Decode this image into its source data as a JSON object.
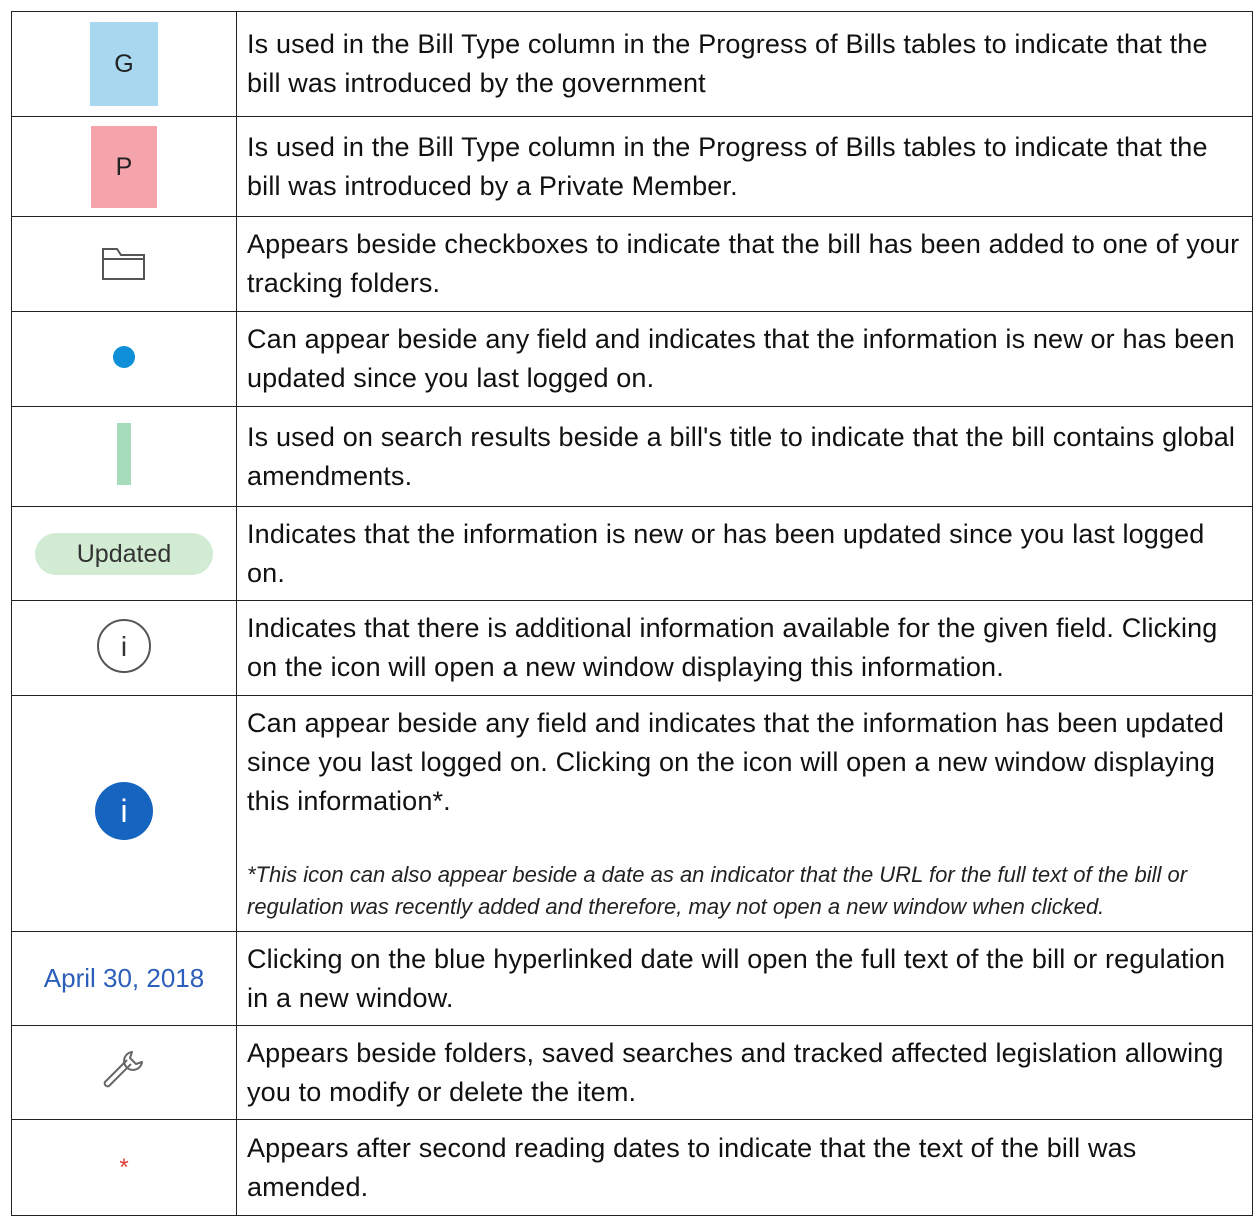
{
  "rows": [
    {
      "icon": "g-badge",
      "badge_text": "G",
      "color": "#a8d8ef",
      "description": "Is used in the Bill Type column in the Progress of Bills tables to indicate that the bill was introduced by the government"
    },
    {
      "icon": "p-badge",
      "badge_text": "P",
      "color": "#f4a4aa",
      "description": "Is used in the Bill Type column in the Progress of Bills tables to indicate that the bill was introduced by a Private Member."
    },
    {
      "icon": "folder-icon",
      "description": "Appears beside checkboxes to indicate that the bill has been added to one of your tracking folders."
    },
    {
      "icon": "blue-dot-icon",
      "color": "#0e8fd8",
      "description": "Can appear beside any field and indicates that the information is new or has been updated since you last logged on."
    },
    {
      "icon": "green-bar-icon",
      "color": "#a6dbbc",
      "description": "Is used on search results beside a bill's title to indicate that the bill contains global amendments."
    },
    {
      "icon": "updated-badge",
      "badge_text": "Updated",
      "color": "#d2ecd3",
      "description": "Indicates that the information is new or has been updated since you last logged on."
    },
    {
      "icon": "info-outline-icon",
      "glyph": "i",
      "description": "Indicates that there is additional information available for the given field. Clicking on the icon will open a new window displaying this information."
    },
    {
      "icon": "info-filled-icon",
      "glyph": "i",
      "color": "#1565c0",
      "description": "Can appear beside any field and indicates that the information has been updated since you last logged on. Clicking on the icon will open a new window displaying this information*.",
      "footnote": "*This icon can also appear beside a date as an indicator that the URL for the full text of the bill or regulation was recently added and therefore, may not open a new window when clicked."
    },
    {
      "icon": "date-link",
      "link_text": "April 30, 2018",
      "color": "#2c5ebb",
      "description": "Clicking on the blue hyperlinked date will open the full text of the bill or regulation in a new window."
    },
    {
      "icon": "wrench-icon",
      "description": "Appears beside folders, saved searches and tracked affected legislation allowing you to modify or delete the item."
    },
    {
      "icon": "asterisk-icon",
      "glyph": "*",
      "color": "#e23b3b",
      "description": "Appears after second reading dates to indicate that the text of the bill was amended."
    }
  ]
}
